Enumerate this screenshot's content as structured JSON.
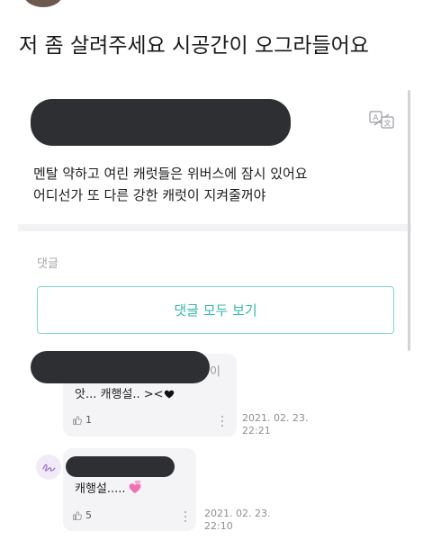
{
  "post": {
    "title": "저 좀 살려주세요 시공간이 오그라들어요",
    "body_lines": [
      "멘탈 약하고 여린 캐럿들은 위버스에 잠시 있어요",
      "어디선가 또 다른 강한 캐럿이 지켜줄꺼야"
    ]
  },
  "comments_section": {
    "label": "댓글",
    "view_all_label": "댓글 모두 보기"
  },
  "comments": [
    {
      "text": "앗... 캐행설.. ><",
      "emoji": "black-heart",
      "likes": "1",
      "date": "2021. 02. 23.",
      "time": "22:21"
    },
    {
      "text": "캐행설.....",
      "emoji": "two-pink-hearts",
      "likes": "5",
      "date": "2021. 02. 23.",
      "time": "22:10"
    }
  ],
  "ghost_char": "이",
  "colors": {
    "accent": "#37b7ad",
    "accent_border": "#7fd6cf",
    "redaction": "#2e2f33",
    "bubble": "#f4f4f6",
    "muted": "#a7a7ad"
  },
  "icons": {
    "translate": "translate-icon",
    "like": "thumbs-up-icon",
    "more": "more-vertical-icon"
  }
}
